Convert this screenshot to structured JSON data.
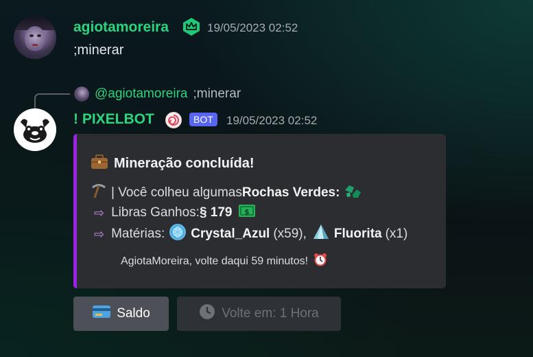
{
  "message_user": {
    "username": "agiotamoreira",
    "timestamp": "19/05/2023 02:52",
    "text": ";minerar"
  },
  "reply": {
    "mention": "@agiotamoreira",
    "text": ";minerar"
  },
  "message_bot": {
    "name": "! PIXELBOT",
    "bot_tag": "BOT",
    "timestamp": "19/05/2023 02:52"
  },
  "embed": {
    "accent_color": "#9b23e5",
    "title": "Mineração concluída!",
    "line1_prefix": "| Você colheu algumas ",
    "line1_bold": "Rochas Verdes:",
    "line2_prefix": "Libras Ganhos: ",
    "line2_bold": "§ 179",
    "line3_prefix": "Matérias: ",
    "line3_item1": "Crystal_Azul",
    "line3_item1_qty": "(x59),",
    "line3_item2": "Fluorita",
    "line3_item2_qty": "(x1)",
    "footer": "AgiotaMoreira, volte daqui 59 minutos!"
  },
  "buttons": {
    "saldo_label": "Saldo",
    "volte_label": "Volte em: 1 Hora"
  },
  "icons": {
    "crown_badge": "crown-shield-icon",
    "briefcase": "briefcase-icon",
    "pickaxe": "pickaxe-icon",
    "green_rocks": "green-rocks-icon",
    "money": "money-icon",
    "crystal": "crystal-icon",
    "fluorite": "fluorite-icon",
    "alarm": "alarm-clock-icon",
    "card": "credit-card-icon",
    "clock": "clock-icon"
  },
  "colors": {
    "username": "#2dd47e",
    "bot_tag": "#5865f2",
    "embed_bg": "#2b2d31"
  }
}
